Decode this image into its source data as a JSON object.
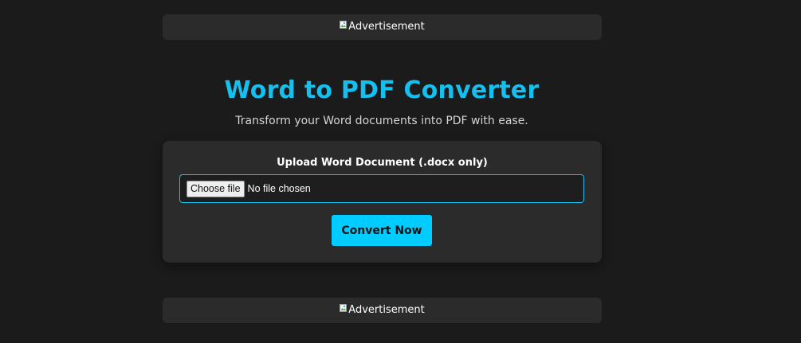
{
  "ads": {
    "top": {
      "alt_text": "Advertisement"
    },
    "bottom": {
      "alt_text": "Advertisement"
    }
  },
  "header": {
    "title": "Word to PDF Converter",
    "subtitle": "Transform your Word documents into PDF with ease."
  },
  "upload": {
    "label": "Upload Word Document (.docx only)",
    "choose_button": "Choose file",
    "file_status": "No file chosen",
    "convert_button": "Convert Now"
  },
  "colors": {
    "accent": "#14c0f0",
    "button": "#00ccff",
    "background": "#1b1b1b",
    "card": "#2b2b2b"
  },
  "icons": {
    "ad_image": "broken-image-icon"
  }
}
